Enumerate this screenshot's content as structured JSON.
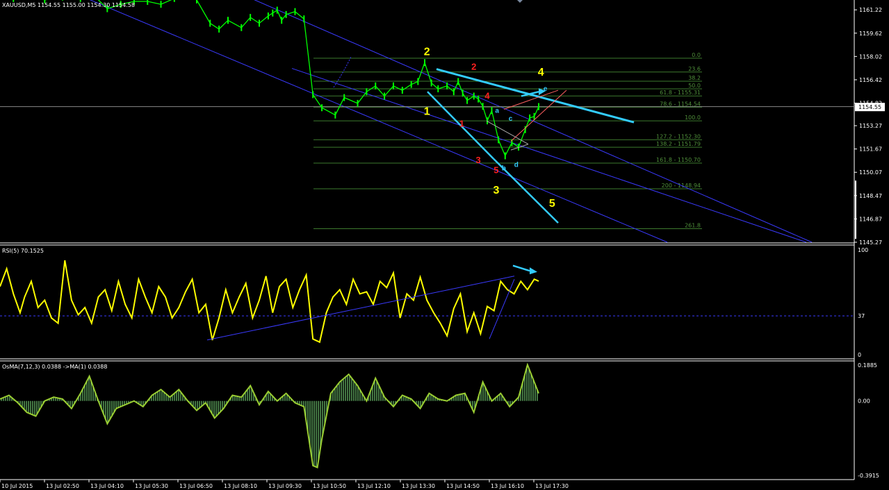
{
  "chart_header": "XAUUSD,M5  1154.55 1155.00 1154.30 1154.58",
  "colors": {
    "background": "#000000",
    "price": "#00ff00",
    "rsi": "#ffff00",
    "osma_line": "#9acd32",
    "osma_hist": "#5aa05a",
    "channel": "#3a3aff",
    "trend": "#33ccff",
    "fib": "#3d7a2e",
    "wave_major": "#ffff00",
    "wave_minor": "#ff2020",
    "wave_sub": "#33ccff"
  },
  "chart_data": [
    {
      "type": "line",
      "name": "price",
      "ylim": [
        1145.27,
        1161.8
      ],
      "y_ticks": [
        "1161.22",
        "1159.62",
        "1158.02",
        "1156.42",
        "1154.82",
        "1153.27",
        "1151.67",
        "1150.07",
        "1148.47",
        "1146.87",
        "1145.27"
      ],
      "current_price": "1154.55",
      "x_ticks": [
        "10 Jul 2015",
        "13 Jul 02:50",
        "13 Jul 04:10",
        "13 Jul 05:30",
        "13 Jul 06:50",
        "13 Jul 08:10",
        "13 Jul 09:30",
        "13 Jul 10:50",
        "13 Jul 12:10",
        "13 Jul 13:30",
        "13 Jul 14:50",
        "13 Jul 16:10",
        "13 Jul 17:30"
      ],
      "x_range": [
        0,
        12.4
      ],
      "series": [
        {
          "x": [
            0,
            0.3,
            0.6,
            1.0,
            1.4,
            1.8,
            2.1,
            2.4,
            2.7,
            3.0,
            3.3,
            3.6,
            3.9,
            4.1,
            4.4,
            4.7,
            4.9,
            5.1,
            5.4,
            5.6,
            5.8,
            6.0,
            6.1,
            6.2,
            6.3,
            6.4,
            6.6,
            6.8,
            7.0,
            7.2,
            7.5,
            7.7,
            8.0,
            8.2,
            8.4,
            8.6,
            8.8,
            9.0,
            9.2,
            9.35,
            9.5,
            9.65,
            9.8,
            10.0,
            10.15,
            10.25,
            10.35,
            10.45,
            10.6,
            10.7,
            10.8,
            10.9,
            11.0,
            11.15,
            11.3,
            11.45,
            11.6,
            11.75,
            11.85,
            11.95,
            12.05
          ],
          "y": [
            1162.2,
            1162.0,
            1162.3,
            1161.9,
            1162.1,
            1162.0,
            1162.2,
            1161.3,
            1161.6,
            1161.8,
            1161.8,
            1161.6,
            1162.0,
            1162.2,
            1161.9,
            1160.3,
            1159.9,
            1160.5,
            1160.0,
            1160.7,
            1160.3,
            1160.8,
            1161.0,
            1161.2,
            1160.5,
            1160.9,
            1161.1,
            1160.6,
            1155.4,
            1154.5,
            1154.0,
            1155.2,
            1154.8,
            1155.6,
            1156.0,
            1155.3,
            1156.0,
            1155.7,
            1156.1,
            1156.3,
            1157.6,
            1156.2,
            1155.8,
            1156.0,
            1155.6,
            1156.3,
            1155.5,
            1155.0,
            1155.3,
            1155.1,
            1154.6,
            1153.6,
            1154.3,
            1152.3,
            1151.2,
            1152.1,
            1151.8,
            1153.0,
            1153.8,
            1153.9,
            1154.58
          ]
        }
      ],
      "fib_levels": [
        {
          "label": "0.0",
          "value": 1157.9
        },
        {
          "label": "23.6",
          "value": 1156.95
        },
        {
          "label": "38.2",
          "value": 1156.32
        },
        {
          "label": "50.0",
          "value": 1155.8
        },
        {
          "label": "61.8 - 1155.31",
          "value": 1155.31
        },
        {
          "label": "78.6 - 1154.54",
          "value": 1154.54
        },
        {
          "label": "100.0",
          "value": 1153.6
        },
        {
          "label": "127.2 - 1152.30",
          "value": 1152.3
        },
        {
          "label": "138.2 - 1151.79",
          "value": 1151.79
        },
        {
          "label": "161.8 - 1150.70",
          "value": 1150.7
        },
        {
          "label": "200 - 1148.94",
          "value": 1148.94
        },
        {
          "label": "261.8",
          "value": 1146.2
        }
      ],
      "wave_labels": [
        {
          "text": "2",
          "x": 9.55,
          "y": 1158.1,
          "group": "major"
        },
        {
          "text": "1",
          "x": 9.55,
          "y": 1154.0,
          "group": "major"
        },
        {
          "text": "3",
          "x": 11.1,
          "y": 1148.6,
          "group": "major"
        },
        {
          "text": "4",
          "x": 12.1,
          "y": 1156.7,
          "group": "major"
        },
        {
          "text": "5",
          "x": 12.35,
          "y": 1147.7,
          "group": "major"
        },
        {
          "text": "2",
          "x": 10.6,
          "y": 1157.1,
          "group": "minor"
        },
        {
          "text": "1",
          "x": 10.33,
          "y": 1153.2,
          "group": "minor"
        },
        {
          "text": "3",
          "x": 10.7,
          "y": 1150.7,
          "group": "minor"
        },
        {
          "text": "4",
          "x": 10.9,
          "y": 1155.1,
          "group": "minor"
        },
        {
          "text": "5",
          "x": 11.1,
          "y": 1150.0,
          "group": "minor"
        },
        {
          "text": "a",
          "x": 11.12,
          "y": 1154.15,
          "group": "sub"
        },
        {
          "text": "b",
          "x": 11.27,
          "y": 1150.2,
          "group": "sub"
        },
        {
          "text": "c",
          "x": 11.42,
          "y": 1153.6,
          "group": "sub"
        },
        {
          "text": "d",
          "x": 11.55,
          "y": 1150.45,
          "group": "sub"
        },
        {
          "text": "e",
          "x": 12.2,
          "y": 1155.65,
          "group": "sub"
        }
      ]
    },
    {
      "type": "line",
      "name": "RSI(5) 70.1525",
      "ylim": [
        0,
        100
      ],
      "y_ticks": [
        "100",
        "37",
        "0"
      ],
      "level": 37,
      "series": [
        {
          "x": [
            0,
            0.15,
            0.3,
            0.45,
            0.55,
            0.7,
            0.85,
            1.0,
            1.15,
            1.3,
            1.45,
            1.6,
            1.75,
            1.9,
            2.05,
            2.2,
            2.35,
            2.5,
            2.65,
            2.8,
            2.95,
            3.1,
            3.25,
            3.4,
            3.55,
            3.7,
            3.85,
            4.0,
            4.15,
            4.3,
            4.45,
            4.6,
            4.75,
            4.9,
            5.05,
            5.2,
            5.35,
            5.5,
            5.65,
            5.8,
            5.95,
            6.1,
            6.25,
            6.4,
            6.55,
            6.7,
            6.85,
            7.0,
            7.15,
            7.3,
            7.45,
            7.6,
            7.75,
            7.9,
            8.05,
            8.2,
            8.35,
            8.5,
            8.65,
            8.8,
            8.95,
            9.1,
            9.25,
            9.4,
            9.55,
            9.7,
            9.85,
            10.0,
            10.15,
            10.3,
            10.45,
            10.6,
            10.75,
            10.9,
            11.05,
            11.2,
            11.35,
            11.5,
            11.65,
            11.8,
            11.95,
            12.05
          ],
          "y": [
            65,
            82,
            58,
            40,
            55,
            70,
            45,
            52,
            35,
            30,
            90,
            52,
            38,
            45,
            30,
            55,
            62,
            42,
            70,
            48,
            35,
            72,
            55,
            40,
            65,
            55,
            35,
            45,
            60,
            72,
            40,
            48,
            14,
            35,
            62,
            40,
            55,
            68,
            35,
            52,
            75,
            40,
            65,
            72,
            45,
            62,
            76,
            15,
            12,
            40,
            55,
            62,
            48,
            72,
            58,
            60,
            48,
            70,
            64,
            78,
            35,
            58,
            52,
            74,
            52,
            40,
            30,
            18,
            44,
            58,
            22,
            40,
            20,
            46,
            42,
            70,
            62,
            58,
            70,
            62,
            72,
            70.15
          ]
        }
      ]
    },
    {
      "type": "area",
      "name": "OsMA(7,12,3) 0.0388  ->MA(1) 0.0388",
      "ylim": [
        -0.3915,
        0.1885
      ],
      "y_ticks": [
        "0.1885",
        "0.00",
        "-0.3915"
      ],
      "series": [
        {
          "x": [
            0,
            0.2,
            0.4,
            0.6,
            0.8,
            1.0,
            1.2,
            1.4,
            1.6,
            1.8,
            2.0,
            2.2,
            2.4,
            2.6,
            2.8,
            3.0,
            3.2,
            3.4,
            3.6,
            3.8,
            4.0,
            4.2,
            4.4,
            4.6,
            4.8,
            5.0,
            5.2,
            5.4,
            5.6,
            5.8,
            6.0,
            6.2,
            6.4,
            6.6,
            6.8,
            7.0,
            7.1,
            7.2,
            7.4,
            7.6,
            7.8,
            8.0,
            8.2,
            8.4,
            8.6,
            8.8,
            9.0,
            9.2,
            9.4,
            9.6,
            9.8,
            10.0,
            10.2,
            10.4,
            10.6,
            10.8,
            11.0,
            11.2,
            11.4,
            11.6,
            11.8,
            12.05
          ],
          "y": [
            0.01,
            0.03,
            -0.01,
            -0.06,
            -0.08,
            0.0,
            0.02,
            0.01,
            -0.04,
            0.04,
            0.13,
            0.0,
            -0.12,
            -0.04,
            -0.02,
            0.0,
            -0.03,
            0.03,
            0.06,
            0.02,
            0.06,
            0.0,
            -0.05,
            -0.01,
            -0.09,
            -0.04,
            0.03,
            0.02,
            0.08,
            -0.02,
            0.05,
            0.0,
            0.04,
            -0.01,
            -0.03,
            -0.34,
            -0.35,
            -0.2,
            0.04,
            0.1,
            0.14,
            0.08,
            0.0,
            0.12,
            0.02,
            -0.03,
            0.03,
            0.01,
            -0.04,
            0.04,
            0.01,
            0.0,
            0.03,
            0.04,
            -0.06,
            0.1,
            0.0,
            0.04,
            -0.03,
            0.02,
            0.19,
            0.04
          ]
        }
      ]
    }
  ]
}
